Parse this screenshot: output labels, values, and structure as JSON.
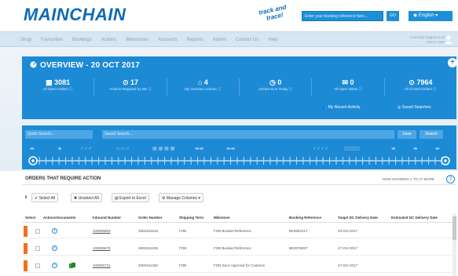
{
  "header": {
    "logo": "MAINCHAIN",
    "track_logo_line1": "track and",
    "track_logo_line2": "trace!",
    "search_placeholder": "Enter your booking reference here...",
    "go_label": "GO",
    "language": "English"
  },
  "nav": {
    "items": [
      "Shop",
      "Favourites",
      "Bookings",
      "Actions",
      "Milestones",
      "Accounts",
      "Reports",
      "Admin",
      "Contact Us",
      "Help"
    ],
    "user_line1": "Currently logged in as",
    "user_line2": "Demo User"
  },
  "overview": {
    "title": "OVERVIEW - 20 OCT 2017",
    "plus": "+",
    "stats": [
      {
        "value": "3081",
        "label": "All Open Orders"
      },
      {
        "value": "17",
        "label": "Actions Required by Me"
      },
      {
        "value": "4",
        "label": "My Overdue Actions"
      },
      {
        "value": "0",
        "label": "Actions Due Today"
      },
      {
        "value": "0",
        "label": "All Open Notes"
      },
      {
        "value": "7964",
        "label": "All Closed Orders"
      }
    ],
    "link_recent": "My Recent Activity",
    "link_saved": "Saved Searches"
  },
  "timeline": {
    "quick_search_placeholder": "Quick Search...",
    "saved_search_placeholder": "Saved Search...",
    "save_label": "Save",
    "search_label": "Search"
  },
  "orders": {
    "title": "ORDERS THAT REQUIRE ACTION",
    "showing": "NOW SHOWING 1 TO 17 MORE",
    "help": "?",
    "toolbar": {
      "select_all": "Select All",
      "unselect_all": "Unselect All",
      "export": "Export to Excel",
      "manage_columns": "Manage Columns"
    },
    "columns": [
      "Select",
      "Actions",
      "Documents",
      "Inbound Number",
      "Order Number",
      "Shipping Term",
      "Milestone",
      "Booking Reference",
      "Target DC Delivery Date",
      "Estimated DC Delivery Date"
    ],
    "rows": [
      {
        "inbound": "100055853",
        "order": "4500151518",
        "term": "FOB",
        "milestone": "FOB Booked Reference",
        "booking": "BK0052417",
        "target": "23-Oct-2017",
        "has_doc": false
      },
      {
        "inbound": "100055875",
        "order": "4500151535",
        "term": "FOB",
        "milestone": "FOB Booked Reference",
        "booking": "BK0076937",
        "target": "27-Oct-2017",
        "has_doc": false
      },
      {
        "inbound": "100055731",
        "order": "4500151262",
        "term": "FOB",
        "milestone": "FOB Docs Approval for Customs",
        "booking": "",
        "target": "27-Oct-2017",
        "has_doc": true
      }
    ]
  },
  "colors": {
    "brand_blue": "#1d8ad6",
    "flag_orange": "#f36f21",
    "logo_blue": "#0e6bb6"
  }
}
